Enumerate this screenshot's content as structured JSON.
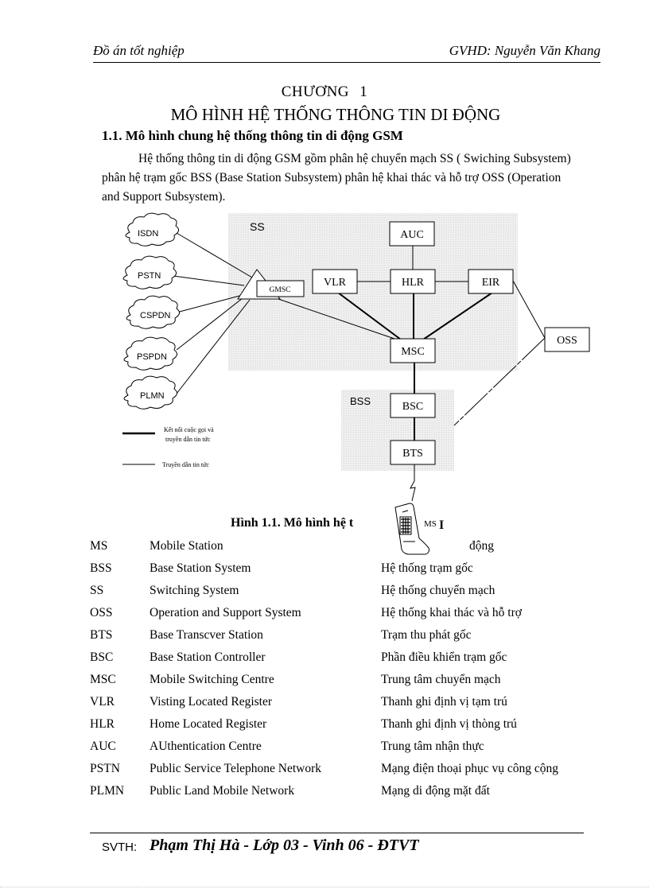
{
  "header": {
    "left": "Đồ án tốt nghiệp",
    "right": "GVHD: Nguyễn Văn Khang"
  },
  "chapter": {
    "number_label": "CHƯƠNG   1",
    "title": "MÔ HÌNH HỆ THỐNG THÔNG TIN DI ĐỘNG"
  },
  "section": {
    "heading": "1.1. Mô hình chung hệ thống thông tin di động GSM",
    "paragraph": "Hệ thống thông tin di động GSM gồm phân hệ chuyển mạch SS ( Swiching Subsystem) phân hệ trạm gốc BSS (Base Station Subsystem) phân hệ khai thác và hỗ trợ OSS (Operation  and Support Subsystem)."
  },
  "diagram": {
    "region_ss_label": "SS",
    "region_bss_label": "BSS",
    "clouds": [
      "ISDN",
      "PSTN",
      "CSPDN",
      "PSPDN",
      "PLMN"
    ],
    "gateway": "GMSC",
    "nodes": {
      "auc": "AUC",
      "vlr": "VLR",
      "hlr": "HLR",
      "eir": "EIR",
      "msc": "MSC",
      "oss": "OSS",
      "bsc": "BSC",
      "bts": "BTS",
      "ms": "MS"
    },
    "legend": [
      {
        "style": "thick",
        "label_line1": "Kết nối cuộc gọi và",
        "label_line2": "truyền dẫn tin tức"
      },
      {
        "style": "thin",
        "label_line1": "Truyền dẫn tin tức",
        "label_line2": ""
      }
    ],
    "ms_suffix": "I"
  },
  "figure": {
    "caption": "Hình 1.1. Mô hình hệ t"
  },
  "glossary": [
    {
      "abbr": "MS",
      "english": "Mobile Station",
      "vietnamese": "động"
    },
    {
      "abbr": "BSS",
      "english": "Base Station System",
      "vietnamese": "Hệ thống trạm gốc"
    },
    {
      "abbr": "SS",
      "english": "Switching System",
      "vietnamese": "Hệ thống chuyển mạch"
    },
    {
      "abbr": "OSS",
      "english": "Operation  and Support System",
      "vietnamese": "Hệ thống khai thác và hỗ trợ"
    },
    {
      "abbr": "BTS",
      "english": "Base Transcver Station",
      "vietnamese": "Trạm thu phát gốc"
    },
    {
      "abbr": "BSC",
      "english": "Base Station Controller",
      "vietnamese": "Phần điều khiển trạm gốc"
    },
    {
      "abbr": "MSC",
      "english": "Mobile Switching Centre",
      "vietnamese": "Trung tâm chuyển mạch"
    },
    {
      "abbr": "VLR",
      "english": "Visting Located Register",
      "vietnamese": "Thanh ghi định vị tạm trú"
    },
    {
      "abbr": "HLR",
      "english": "Home Located Register",
      "vietnamese": "Thanh ghi định vị thòng   trú"
    },
    {
      "abbr": "AUC",
      "english": "AUthentication  Centre",
      "vietnamese": "Trung tâm nhận thực"
    },
    {
      "abbr": "PSTN",
      "english": "Public Service Telephone Network",
      "vietnamese": "Mạng điện thoại phục vụ công cộng"
    },
    {
      "abbr": "PLMN",
      "english": "Public Land Mobile Network",
      "vietnamese": "Mạng di động mặt đất"
    }
  ],
  "footer": {
    "label": "SVTH:",
    "author": "Phạm Thị Hà - Lớp 03 - Vinh 06 - ĐTVT"
  }
}
